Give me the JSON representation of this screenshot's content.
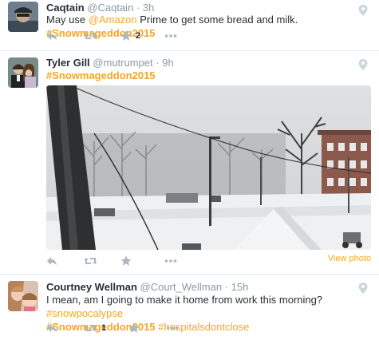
{
  "tweets": [
    {
      "name": "Caqtain",
      "handle": "@Caqtain",
      "dot": "·",
      "time": "3h",
      "text_before": "May use ",
      "mention": "@Amazon",
      "text_after": " Prime to get some bread and milk. ",
      "hashtag": "#Snowmageddon2015",
      "favorite_count": "2"
    },
    {
      "name": "Tyler Gill",
      "handle": "@mutrumpet",
      "dot": "·",
      "time": "9h",
      "hashtag": "#Snowmageddon2015",
      "view_photo": "View photo"
    },
    {
      "name": "Courtney Wellman",
      "handle": "@Court_Wellman",
      "dot": "·",
      "time": "15h",
      "text_before": "I mean, am I going to make it home from work this morning? ",
      "hashtag1": "#snowpocalypse",
      "hashtag2": "#Snowmageddon2015",
      "hashtag3": "#hospitalsdontclose",
      "retweet_count": "1"
    }
  ],
  "colors": {
    "accent": "#f5a623",
    "muted": "#8899a6",
    "text": "#292f33"
  },
  "icons": [
    "reply-icon",
    "retweet-icon",
    "favorite-icon",
    "more-icon",
    "location-pin-icon"
  ]
}
